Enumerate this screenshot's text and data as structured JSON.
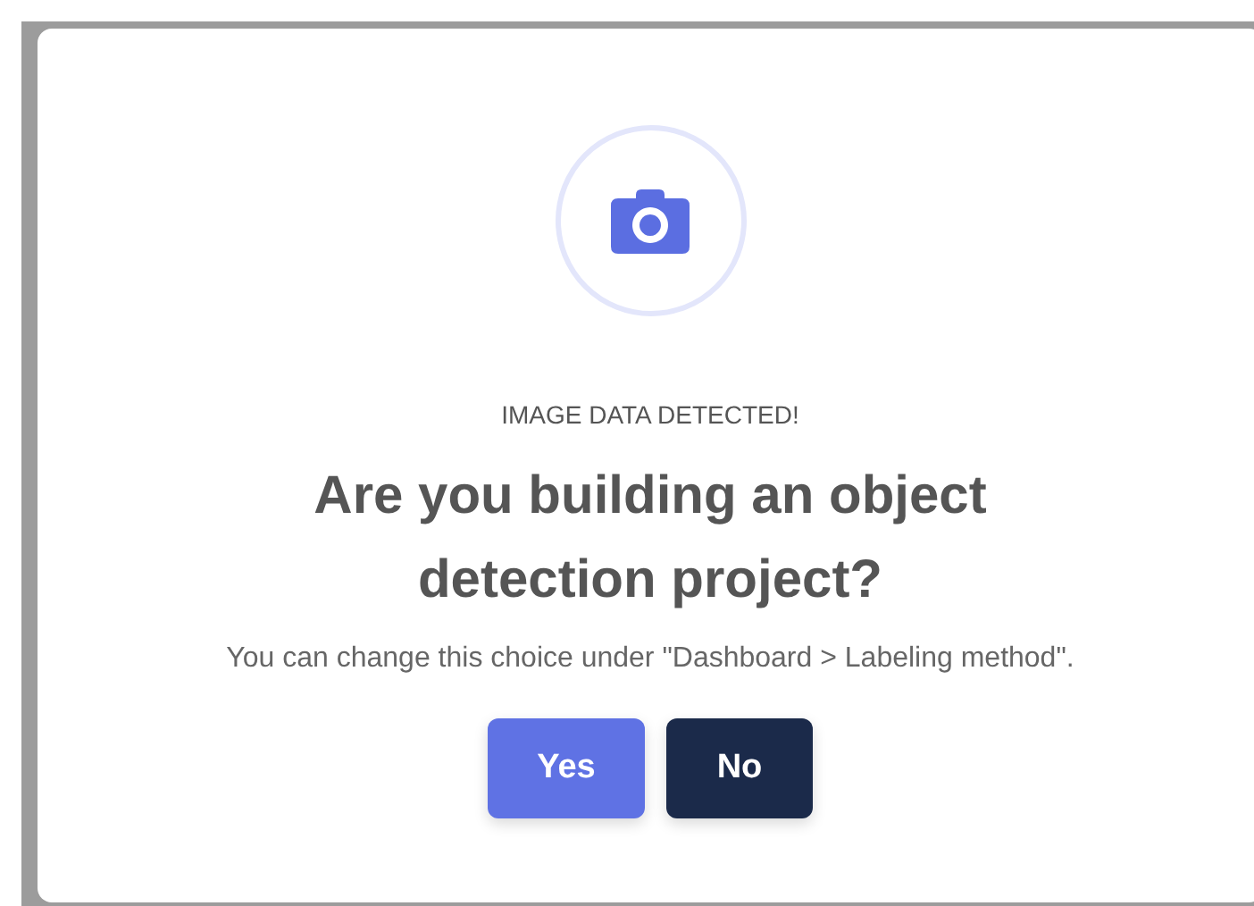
{
  "dialog": {
    "eyebrow": "IMAGE DATA DETECTED!",
    "title": "Are you building an object detection project?",
    "message": "You can change this choice under \"Dashboard > Labeling method\".",
    "buttons": [
      {
        "label": "Yes",
        "kind": "primary"
      },
      {
        "label": "No",
        "kind": "dark"
      }
    ]
  }
}
